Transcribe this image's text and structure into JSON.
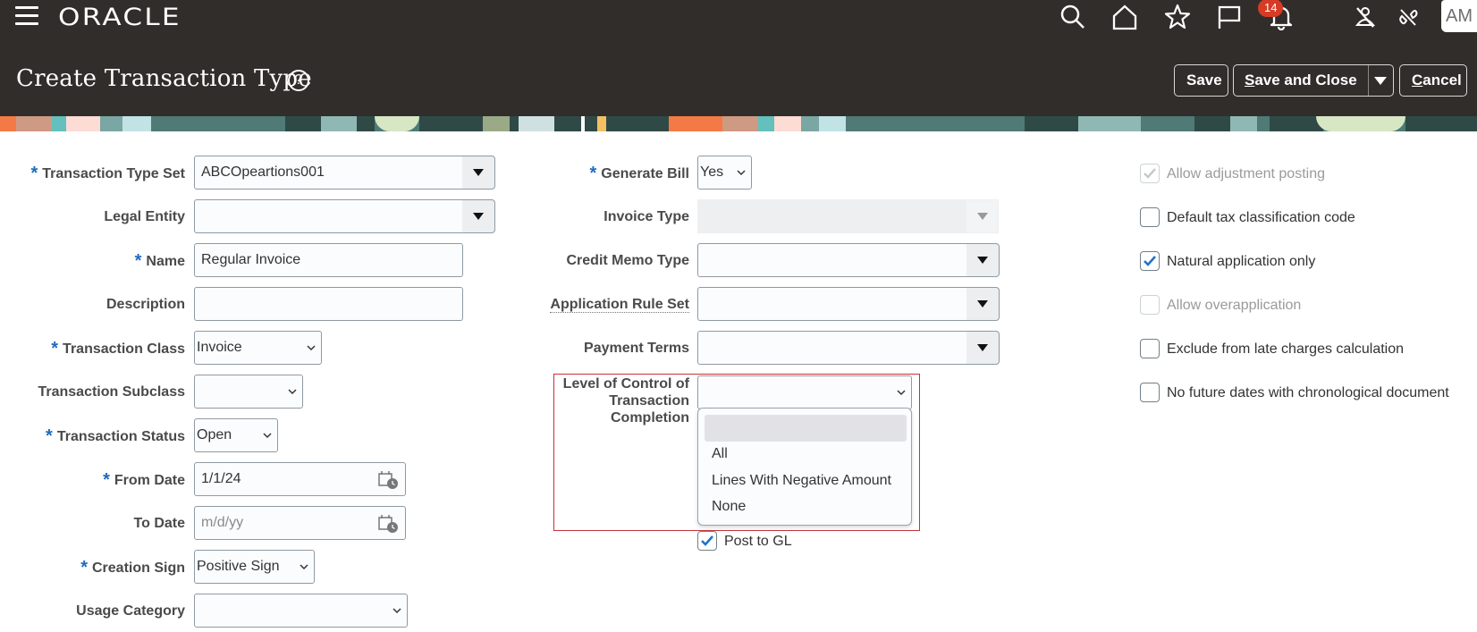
{
  "header": {
    "brand": "ORACLE",
    "notification_count": "14",
    "avatar_initials": "AM",
    "icons": [
      "menu-icon",
      "search-icon",
      "home-icon",
      "favorites-star-icon",
      "flag-icon",
      "notifications-bell-icon",
      "accessibility-person-icon",
      "signout-link-icon"
    ]
  },
  "page": {
    "title": "Create Transaction Type",
    "buttons": {
      "save": "Save",
      "save_and_close_prefix": "S",
      "save_and_close_rest": "ave and Close",
      "cancel_prefix": "C",
      "cancel_rest": "ancel"
    }
  },
  "form": {
    "left": {
      "transaction_type_set": {
        "label": "Transaction Type Set",
        "required": true,
        "value": "ABCOpeartions001"
      },
      "legal_entity": {
        "label": "Legal Entity",
        "required": false,
        "value": ""
      },
      "name": {
        "label": "Name",
        "required": true,
        "value": "Regular Invoice"
      },
      "description": {
        "label": "Description",
        "required": false,
        "value": ""
      },
      "transaction_class": {
        "label": "Transaction Class",
        "required": true,
        "value": "Invoice"
      },
      "transaction_subclass": {
        "label": "Transaction Subclass",
        "required": false,
        "value": ""
      },
      "transaction_status": {
        "label": "Transaction Status",
        "required": true,
        "value": "Open"
      },
      "from_date": {
        "label": "From Date",
        "required": true,
        "value": "1/1/24"
      },
      "to_date": {
        "label": "To Date",
        "required": false,
        "value": "",
        "placeholder": "m/d/yy"
      },
      "creation_sign": {
        "label": "Creation Sign",
        "required": true,
        "value": "Positive Sign"
      },
      "usage_category": {
        "label": "Usage Category",
        "required": false,
        "value": ""
      }
    },
    "middle": {
      "generate_bill": {
        "label": "Generate Bill",
        "required": true,
        "value": "Yes"
      },
      "invoice_type": {
        "label": "Invoice Type",
        "value": "",
        "disabled": true
      },
      "credit_memo_type": {
        "label": "Credit Memo Type",
        "value": ""
      },
      "application_rule_set": {
        "label": "Application Rule Set",
        "value": ""
      },
      "payment_terms": {
        "label": "Payment Terms",
        "value": ""
      },
      "level_of_control": {
        "label_line1": "Level of Control of",
        "label_line2": "Transaction",
        "label_line3": "Completion",
        "value": "",
        "options": [
          "",
          "All",
          "Lines With Negative Amount",
          "None"
        ],
        "dropdown_open": true
      },
      "post_to_gl": {
        "label": "Post to GL",
        "checked": true
      }
    },
    "right": {
      "checkboxes": [
        {
          "label": "Allow adjustment posting",
          "checked": true,
          "disabled": true
        },
        {
          "label": "Default tax classification code",
          "checked": false,
          "disabled": false
        },
        {
          "label": "Natural application only",
          "checked": true,
          "disabled": false
        },
        {
          "label": "Allow overapplication",
          "checked": false,
          "disabled": true
        },
        {
          "label": "Exclude from late charges calculation",
          "checked": false,
          "disabled": false
        },
        {
          "label": "No future dates with chronological document",
          "checked": false,
          "disabled": false
        }
      ]
    }
  },
  "colors": {
    "header_bg": "#312d2a",
    "required_asterisk": "#1f6bbf",
    "badge": "#d63b25",
    "checkmark": "#1f74c9",
    "highlight_border": "#c3323a"
  }
}
